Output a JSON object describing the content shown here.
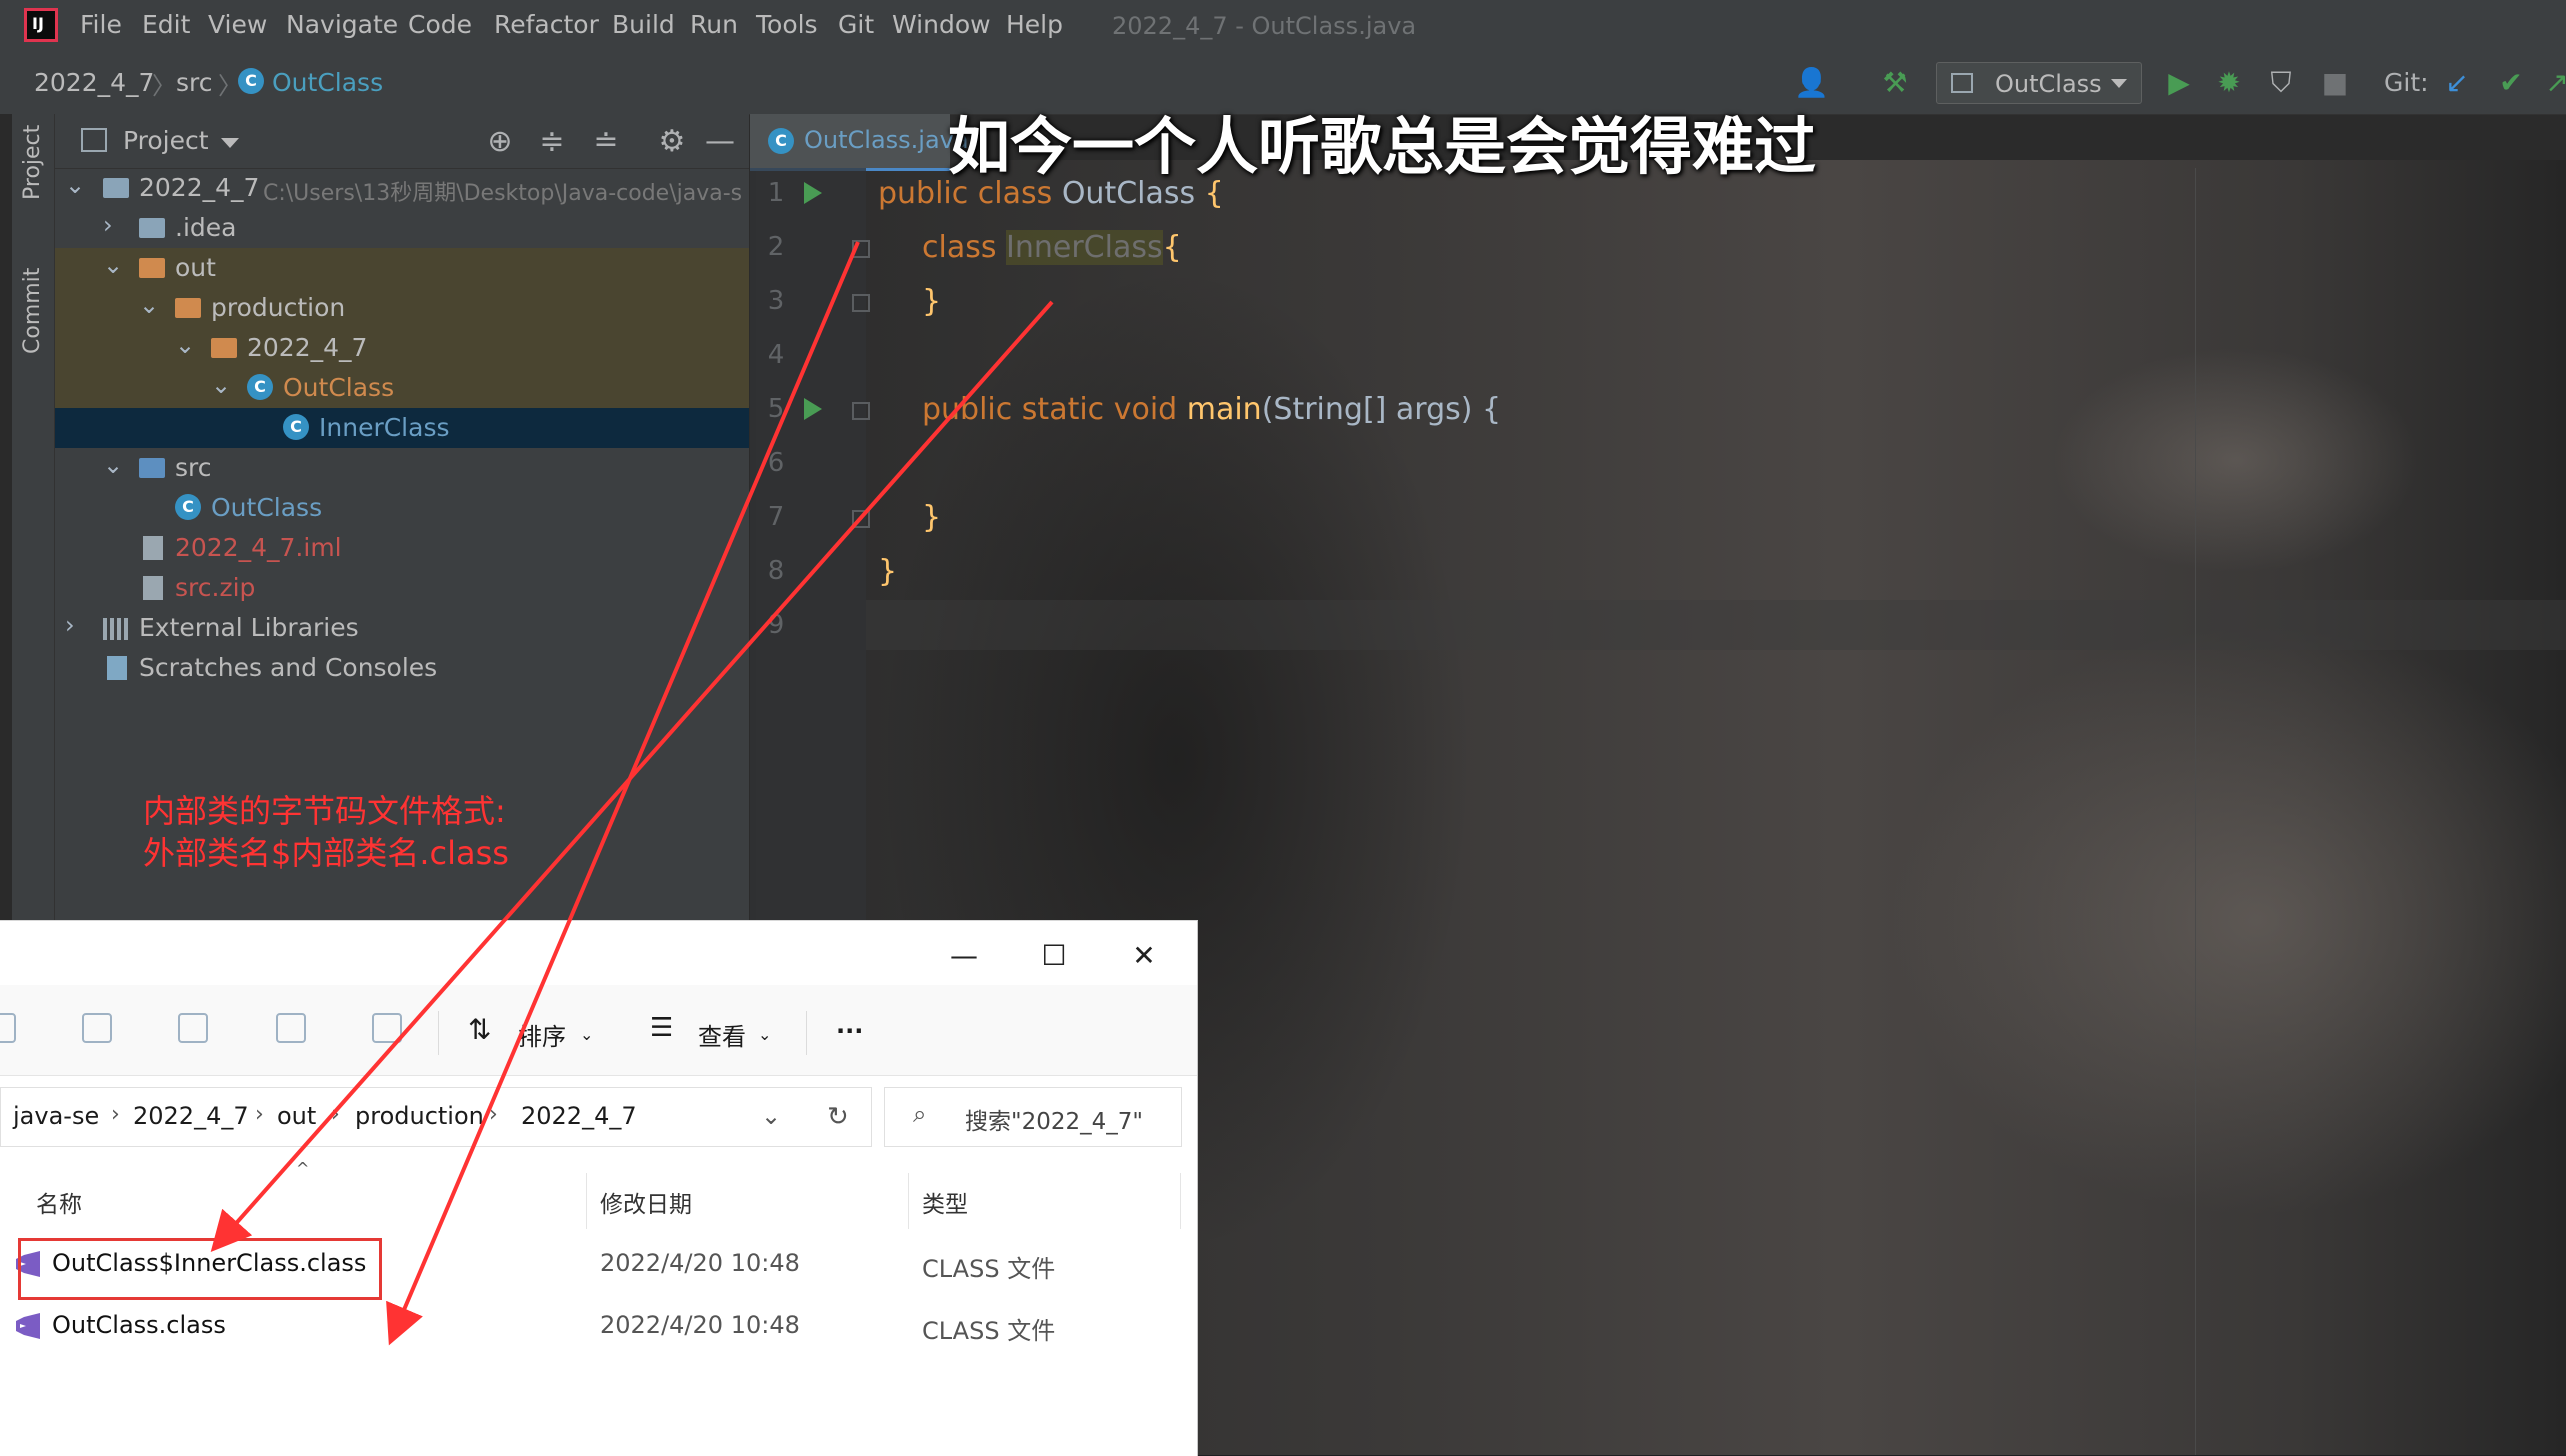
{
  "menubar": {
    "items": [
      "File",
      "Edit",
      "View",
      "Navigate",
      "Code",
      "Refactor",
      "Build",
      "Run",
      "Tools",
      "Git",
      "Window",
      "Help"
    ],
    "title": "2022_4_7 - OutClass.java"
  },
  "navbar": {
    "breadcrumb": [
      "2022_4_7",
      "src",
      "OutClass"
    ],
    "run_config": "OutClass",
    "git_label": "Git:"
  },
  "stripe": {
    "project_label": "Project",
    "commit_label": "Commit"
  },
  "project_panel": {
    "title": "Project",
    "tree": [
      {
        "label": "2022_4_7",
        "path": "C:\\Users\\13秒周期\\Desktop\\Java-code\\java-s"
      },
      {
        "label": ".idea"
      },
      {
        "label": "out"
      },
      {
        "label": "production"
      },
      {
        "label": "2022_4_7"
      },
      {
        "label": "OutClass"
      },
      {
        "label": "InnerClass"
      },
      {
        "label": "src"
      },
      {
        "label": "OutClass"
      },
      {
        "label": "2022_4_7.iml"
      },
      {
        "label": "src.zip"
      },
      {
        "label": "External Libraries"
      },
      {
        "label": "Scratches and Consoles"
      }
    ],
    "annotation_line1": "内部类的字节码文件格式:",
    "annotation_line2": "外部类名$内部类名.class"
  },
  "editor": {
    "tab": "OutClass.java",
    "line_numbers": [
      "1",
      "2",
      "3",
      "4",
      "5",
      "6",
      "7",
      "8",
      "9"
    ],
    "code": {
      "l1_kw": "public class ",
      "l1_name": "OutClass",
      "l1_brace": " {",
      "l2_kw": "class ",
      "l2_name": "InnerClass",
      "l2_brace": "{",
      "l3": "}",
      "l5_kw": "public static void ",
      "l5_fn": "main",
      "l5_rest": "(String[] args) {",
      "l7": "}",
      "l8": "}"
    },
    "subtitle": "如今一个人听歌总是会觉得难过"
  },
  "explorer": {
    "toolbar": {
      "sort_label": "排序",
      "view_label": "查看",
      "more_label": "···"
    },
    "address": [
      "java-se",
      "2022_4_7",
      "out",
      "production",
      "2022_4_7"
    ],
    "search_placeholder": "搜索\"2022_4_7\"",
    "columns": [
      "名称",
      "修改日期",
      "类型"
    ],
    "files": [
      {
        "name": "OutClass$InnerClass.class",
        "date": "2022/4/20 10:48",
        "type": "CLASS 文件"
      },
      {
        "name": "OutClass.class",
        "date": "2022/4/20 10:48",
        "type": "CLASS 文件"
      }
    ]
  },
  "colors": {
    "annotation": "#ff3333",
    "keyword": "#cc7832",
    "function": "#ffc66d",
    "run_green": "#499c54"
  }
}
